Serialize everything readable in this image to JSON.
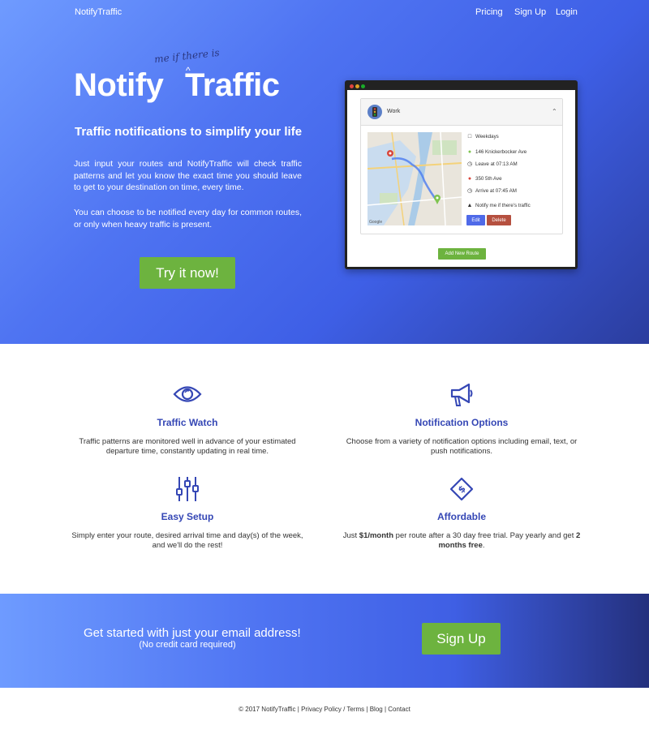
{
  "nav": {
    "brand": "NotifyTraffic",
    "links": [
      "Pricing",
      "Sign Up",
      "Login"
    ]
  },
  "hero": {
    "logo_word1": "Notify",
    "logo_word2": "Traffic",
    "handwritten_insert": "me if there is",
    "caret": "^",
    "tagline": "Traffic notifications to simplify your life",
    "para1": "Just input your routes and NotifyTraffic will check traffic patterns and let you know the exact time you should leave to get to your destination on time, every time.",
    "para2": "You can choose to be notified every day for common routes, or only when heavy traffic is present.",
    "cta": "Try it now!"
  },
  "mockup": {
    "route_name": "Work",
    "days": "Weekdays",
    "origin": "146 Knickerbocker Ave",
    "leave": "Leave at 07:13 AM",
    "destination": "350 5th Ave",
    "arrive": "Arrive at 07:45 AM",
    "notify": "Notify me if there's traffic",
    "edit": "Edit",
    "delete": "Delete",
    "add": "Add New Route",
    "map_brand": "Google"
  },
  "features": [
    {
      "icon": "eye-icon",
      "title": "Traffic Watch",
      "text": "Traffic patterns are monitored well in advance of your estimated departure time, constantly updating in real time."
    },
    {
      "icon": "megaphone-icon",
      "title": "Notification Options",
      "text": "Choose from a variety of notification options including email, text, or push notifications."
    },
    {
      "icon": "sliders-icon",
      "title": "Easy Setup",
      "text": "Simply enter your route, desired arrival time and day(s) of the week, and we'll do the rest!"
    },
    {
      "icon": "money-icon",
      "title": "Affordable",
      "text_a": "Just ",
      "text_b": "$1/month",
      "text_c": " per route after a 30 day free trial. Pay yearly and get ",
      "text_d": "2 months free",
      "text_e": "."
    }
  ],
  "cta": {
    "line1": "Get started with just your email address!",
    "line2": "(No credit card required)",
    "button": "Sign Up"
  },
  "footer": {
    "copyright": "© 2017 NotifyTraffic",
    "links": [
      "Privacy Policy",
      "Terms",
      "Blog",
      "Contact"
    ]
  },
  "colors": {
    "accent": "#3547b5",
    "green": "#6db33f",
    "delete": "#b5503f"
  }
}
